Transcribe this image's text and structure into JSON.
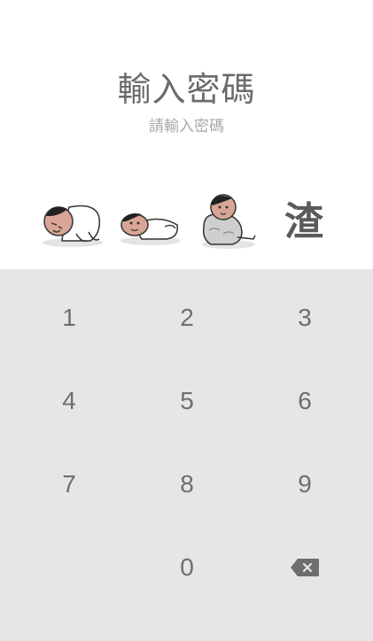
{
  "header": {
    "title": "輸入密碼",
    "subtitle": "請輸入密碼"
  },
  "slots": [
    {
      "type": "sticker",
      "icon": "sleeping-cartoon-man-sticker"
    },
    {
      "type": "sticker",
      "icon": "lying-cartoon-man-sticker"
    },
    {
      "type": "sticker",
      "icon": "sitting-cartoon-man-sticker"
    },
    {
      "type": "character",
      "char": "渣"
    }
  ],
  "keypad": {
    "keys": [
      "1",
      "2",
      "3",
      "4",
      "5",
      "6",
      "7",
      "8",
      "9",
      "0"
    ],
    "backspace_icon": "backspace-icon"
  },
  "colors": {
    "keypad_background": "#e6e6e6",
    "key_text": "#6e6e6e",
    "title_text": "#6b6b6b",
    "subtitle_text": "#a8a8a8"
  }
}
